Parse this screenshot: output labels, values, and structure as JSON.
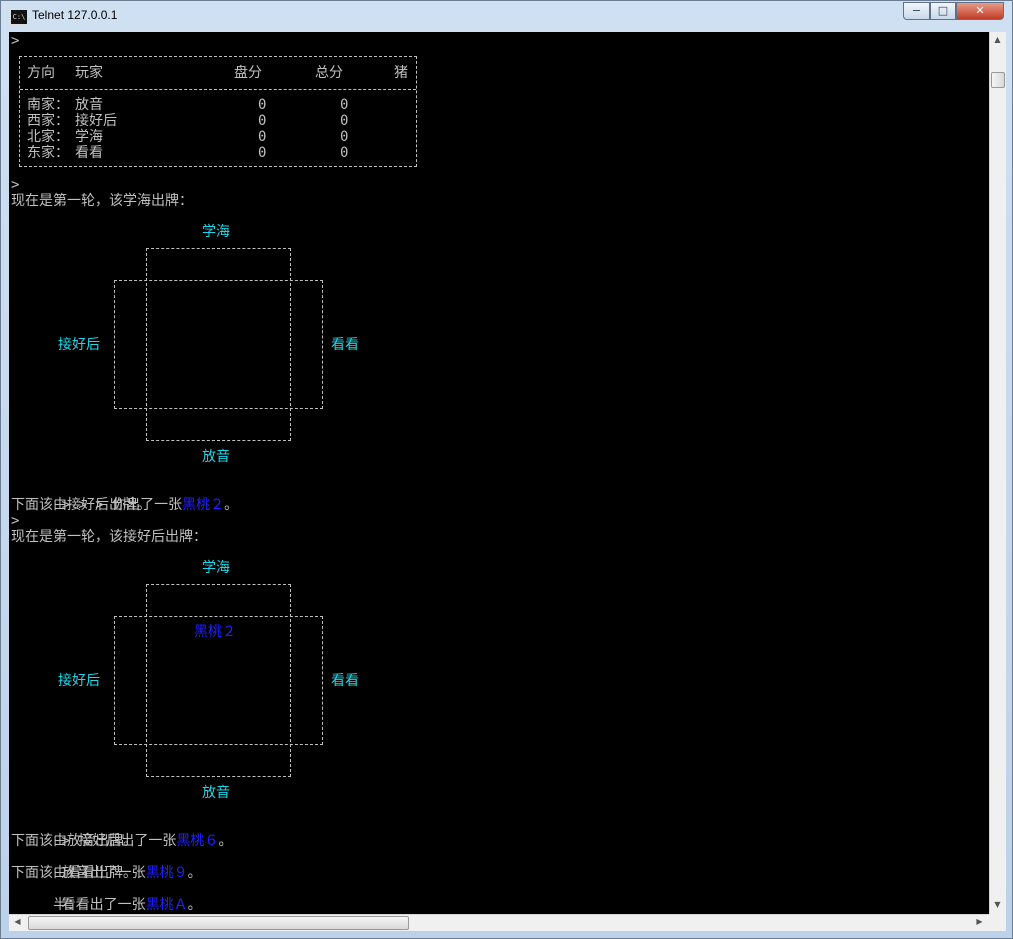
{
  "window": {
    "title": "Telnet 127.0.0.1",
    "min": "−",
    "max": "□",
    "close": "✕",
    "app_icon": "C:\\"
  },
  "score_table": {
    "headers": [
      "方向",
      "玩家",
      "盘分",
      "总分",
      "猪"
    ],
    "rows": [
      {
        "dir": "南家：",
        "player": "放音",
        "round": "0",
        "total": "0"
      },
      {
        "dir": "西家：",
        "player": "接好后",
        "round": "0",
        "total": "0"
      },
      {
        "dir": "北家：",
        "player": "学海",
        "round": "0",
        "total": "0"
      },
      {
        "dir": "东家：",
        "player": "看看",
        "round": "0",
        "total": "0"
      }
    ]
  },
  "console": {
    "prompt": ">",
    "round1": "现在是第一轮，该学海出牌：",
    "table1": {
      "top": "学海",
      "left": "接好后",
      "right": "看看",
      "bottom": "放音",
      "center": ""
    },
    "play1_prefix": "> > > 你出了一张",
    "play1_card": "黑桃２",
    "period": "。",
    "next1": "下面该由接好后出牌。",
    "round2": "现在是第一轮，该接好后出牌：",
    "table2": {
      "top": "学海",
      "left": "接好后",
      "right": "看看",
      "bottom": "放音",
      "center": "黑桃２"
    },
    "play2_prefix": "> 接好后出了一张",
    "play2_card": "黑桃６",
    "next2": "下面该由放音出牌。",
    "play3_prefix": "放音出了一张",
    "play3_card": "黑桃９",
    "next3": "下面该由看看出牌。",
    "play4_prefix": "看看出了一张",
    "play4_card": "黑桃Ａ",
    "last_line": "     半："
  },
  "colors": {
    "console_bg": "#000000",
    "text": "#c0c0c0",
    "player_name": "#20d6e8",
    "card": "#2020ff"
  },
  "icons": {
    "scroll_up": "arrow-up-icon",
    "scroll_down": "arrow-down-icon",
    "scroll_left": "arrow-left-icon",
    "scroll_right": "arrow-right-icon"
  }
}
